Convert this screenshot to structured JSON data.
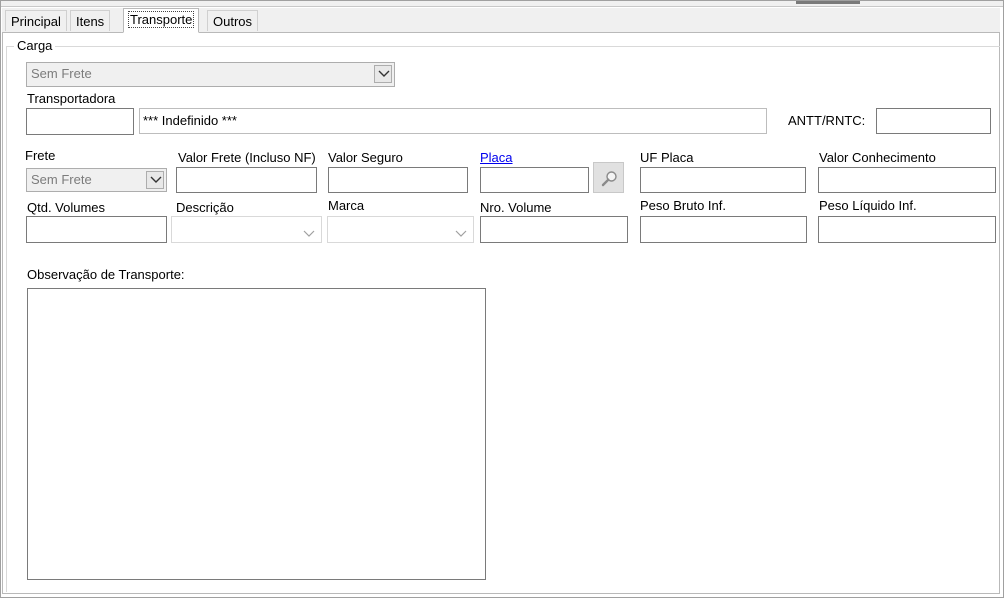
{
  "tabs": [
    "Principal",
    "Itens",
    "Transporte",
    "Outros"
  ],
  "active_tab": "Transporte",
  "carga": {
    "group_title": "Carga",
    "tipo_frete_select": "Sem Frete"
  },
  "transportadora": {
    "label": "Transportadora",
    "code": "",
    "name": "*** Indefinido ***",
    "antt_label": "ANTT/RNTC:",
    "antt_value": ""
  },
  "row1": {
    "frete_label": "Frete",
    "frete_value": "Sem Frete",
    "valor_frete_label": "Valor Frete (Incluso NF)",
    "valor_frete_value": "",
    "valor_seguro_label": "Valor Seguro",
    "valor_seguro_value": "",
    "placa_label": "Placa",
    "placa_value": "",
    "uf_placa_label": "UF Placa",
    "uf_placa_value": "",
    "valor_conhecimento_label": "Valor Conhecimento",
    "valor_conhecimento_value": ""
  },
  "row2": {
    "qtd_volumes_label": "Qtd. Volumes",
    "qtd_volumes_value": "",
    "descricao_label": "Descrição",
    "descricao_value": "",
    "marca_label": "Marca",
    "marca_value": "",
    "nro_volume_label": "Nro. Volume",
    "nro_volume_value": "",
    "peso_bruto_label": "Peso Bruto Inf.",
    "peso_bruto_value": "",
    "peso_liquido_label": "Peso Líquido Inf.",
    "peso_liquido_value": ""
  },
  "observacao": {
    "label": "Observação de Transporte:",
    "value": ""
  },
  "icons": {
    "placa_search": "magnifier-icon"
  }
}
